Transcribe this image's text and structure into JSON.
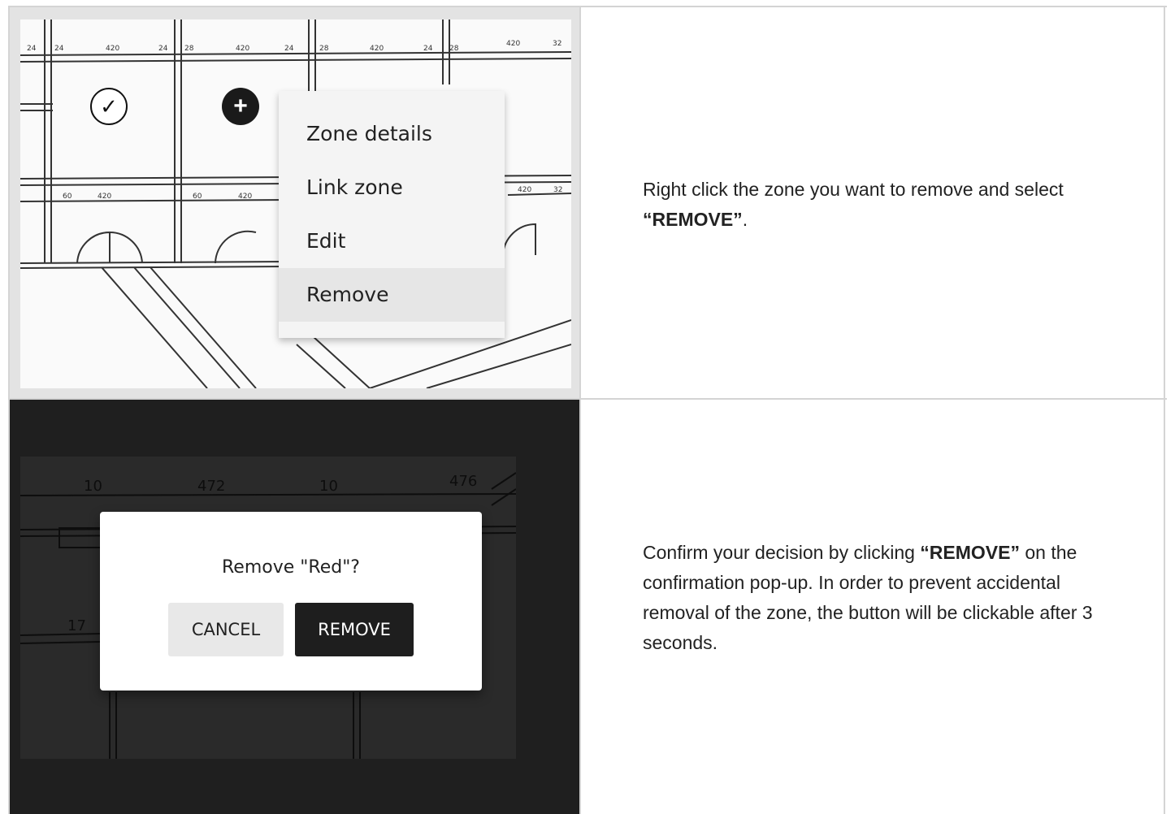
{
  "step1": {
    "menu": {
      "items": [
        "Zone details",
        "Link zone",
        "Edit",
        "Remove"
      ]
    },
    "dimensions": [
      "24",
      "24",
      "420",
      "24",
      "28",
      "420",
      "24",
      "28",
      "420",
      "24",
      "28",
      "420",
      "32",
      "60",
      "420",
      "60",
      "420",
      "420",
      "32"
    ],
    "instruction": {
      "text_before": "Right click the zone you want to remove and select ",
      "bold": "“REMOVE”",
      "text_after": "."
    }
  },
  "step2": {
    "dimensions": [
      "10",
      "472",
      "10",
      "476",
      "17"
    ],
    "dialog": {
      "title": "Remove \"Red\"?",
      "cancel_label": "CANCEL",
      "remove_label": "REMOVE"
    },
    "instruction": {
      "text_before": "Confirm your decision by clicking ",
      "bold": "“REMOVE”",
      "text_after": " on the confirmation pop-up. In order to prevent accidental removal of the zone, the button will be clickable after 3 seconds."
    }
  },
  "colors": {
    "dark_overlay": "#1f1f1f",
    "menu_bg": "#f4f4f4",
    "primary_button": "#1e1e1e"
  }
}
